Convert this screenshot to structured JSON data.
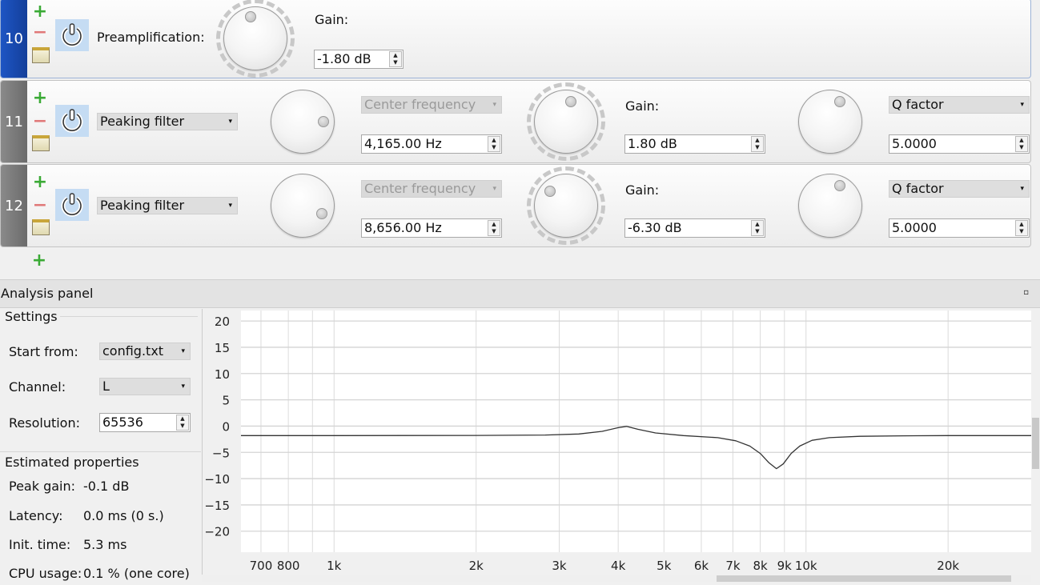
{
  "filters": [
    {
      "index": "10",
      "type_label": "Preamplification:",
      "gain_label": "Gain:",
      "gain_value": "-1.80 dB",
      "selected": true
    },
    {
      "index": "11",
      "type": "Peaking filter",
      "freq_label": "Center frequency",
      "freq_value": "4,165.00 Hz",
      "gain_label": "Gain:",
      "gain_value": "1.80 dB",
      "q_label": "Q factor",
      "q_value": "5.0000"
    },
    {
      "index": "12",
      "type": "Peaking filter",
      "freq_label": "Center frequency",
      "freq_value": "8,656.00 Hz",
      "gain_label": "Gain:",
      "gain_value": "-6.30 dB",
      "q_label": "Q factor",
      "q_value": "5.0000"
    }
  ],
  "icons": {
    "add": "plus-icon",
    "remove": "minus-icon",
    "edit": "notepad-pencil-icon",
    "power": "power-icon"
  },
  "analysis": {
    "title": "Analysis panel",
    "settings": {
      "title": "Settings",
      "start_from_label": "Start from:",
      "start_from_value": "config.txt",
      "channel_label": "Channel:",
      "channel_value": "L",
      "resolution_label": "Resolution:",
      "resolution_value": "65536"
    },
    "estimated": {
      "title": "Estimated properties",
      "peak_gain_label": "Peak gain:",
      "peak_gain_value": "-0.1 dB",
      "latency_label": "Latency:",
      "latency_value": "0.0 ms (0 s.)",
      "init_time_label": "Init. time:",
      "init_time_value": "5.3 ms",
      "cpu_label": "CPU usage:",
      "cpu_value": "0.1 % (one core)"
    }
  },
  "colors": {
    "selected_tab": "#1a4fb8",
    "tab": "#777777",
    "power_bg": "#c5dcf3",
    "add": "#3aaa35",
    "remove": "#e07878"
  },
  "chart_data": {
    "type": "line",
    "x_scale": "log",
    "xlim": [
      635,
      30000
    ],
    "ylim": [
      -24,
      22
    ],
    "grid": true,
    "y_ticks": [
      20,
      15,
      10,
      5,
      0,
      -5,
      -10,
      -15,
      -20
    ],
    "x_ticks": [
      {
        "v": 700,
        "label": "700"
      },
      {
        "v": 800,
        "label": "800"
      },
      {
        "v": 900,
        "label": ""
      },
      {
        "v": 1000,
        "label": "1k"
      },
      {
        "v": 2000,
        "label": "2k"
      },
      {
        "v": 3000,
        "label": "3k"
      },
      {
        "v": 4000,
        "label": "4k"
      },
      {
        "v": 5000,
        "label": "5k"
      },
      {
        "v": 6000,
        "label": "6k"
      },
      {
        "v": 7000,
        "label": "7k"
      },
      {
        "v": 8000,
        "label": "8k"
      },
      {
        "v": 9000,
        "label": "9k"
      },
      {
        "v": 10000,
        "label": "10k"
      },
      {
        "v": 20000,
        "label": "20k"
      }
    ],
    "series": [
      {
        "color": "#333333",
        "points": [
          [
            635,
            -1.8
          ],
          [
            1000,
            -1.8
          ],
          [
            2000,
            -1.78
          ],
          [
            2800,
            -1.7
          ],
          [
            3300,
            -1.5
          ],
          [
            3700,
            -1.0
          ],
          [
            4000,
            -0.3
          ],
          [
            4165,
            -0.05
          ],
          [
            4400,
            -0.6
          ],
          [
            4800,
            -1.3
          ],
          [
            5500,
            -1.8
          ],
          [
            6500,
            -2.2
          ],
          [
            7100,
            -2.8
          ],
          [
            7600,
            -3.8
          ],
          [
            8000,
            -5.2
          ],
          [
            8350,
            -7.0
          ],
          [
            8656,
            -8.1
          ],
          [
            8950,
            -7.2
          ],
          [
            9300,
            -5.2
          ],
          [
            9700,
            -3.8
          ],
          [
            10300,
            -2.7
          ],
          [
            11200,
            -2.2
          ],
          [
            13000,
            -1.95
          ],
          [
            16000,
            -1.85
          ],
          [
            20000,
            -1.8
          ],
          [
            30000,
            -1.8
          ]
        ]
      }
    ]
  }
}
